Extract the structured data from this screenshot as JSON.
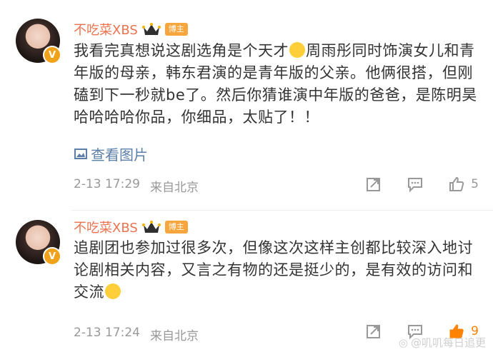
{
  "comments": [
    {
      "username": "不吃菜XBS",
      "badge": "博主",
      "text_part1": "我看完真想说这剧选角是个天才",
      "emoji_name": "laugh-cry-emoji",
      "text_part2": "周雨彤同时饰演女儿和青年版的母亲，韩东君演的是青年版的父亲。他俩很搭，但刚磕到下一秒就be了。然后你猜谁演中年版的爸爸，是陈明昊哈哈哈哈你品，你细品，太贴了！！",
      "view_images_label": "查看图片",
      "timestamp": "2-13 17:29",
      "location": "来自北京",
      "like_count": "5"
    },
    {
      "username": "不吃菜XBS",
      "badge": "博主",
      "text_part1": "追剧团也参加过很多次，但像这次这样主创都比较深入地讨论剧相关内容，又言之有物的还是挺少的，是有效的访问和交流",
      "emoji_name": "emoji",
      "timestamp": "2-13 17:24",
      "location": "来自北京",
      "like_count": "9"
    }
  ],
  "watermark": "@叽叽每日追更"
}
